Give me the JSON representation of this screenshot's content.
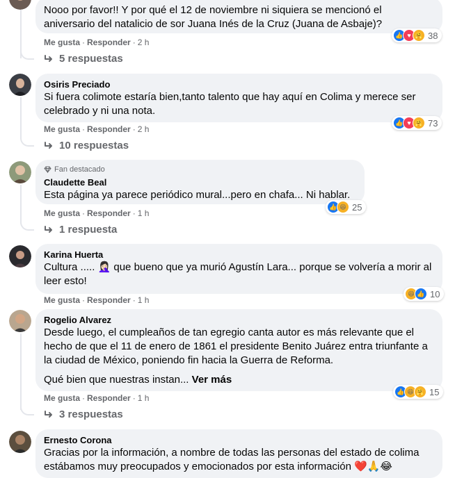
{
  "ui": {
    "like_label": "Me gusta",
    "reply_label": "Responder",
    "sep": "·",
    "fan_badge": "Fan destacado",
    "see_more": "Ver más"
  },
  "comments": [
    {
      "author": "",
      "text": "Nooo por favor!! Y por qué el 12 de noviembre ni siquiera se mencionó el aniversario del natalicio de sor Juana Inés de la Cruz (Juana de Asbaje)?",
      "time": "2 h",
      "reactions": [
        "like",
        "love",
        "care"
      ],
      "reaction_count": "38",
      "replies": "5 respuestas"
    },
    {
      "author": "Osiris Preciado",
      "text": "Si fuera colimote estaría bien,tanto talento que hay aquí en Colima y merece ser celebrado y ni una nota.",
      "time": "2 h",
      "reactions": [
        "like",
        "love",
        "care"
      ],
      "reaction_count": "73",
      "replies": "10 respuestas"
    },
    {
      "author": "Claudette Beal",
      "badge": "Fan destacado",
      "text": "Esta página ya parece periódico mural...pero en chafa... Ni hablar.",
      "time": "1 h",
      "reactions": [
        "like",
        "haha"
      ],
      "reaction_count": "25",
      "replies": "1 respuesta"
    },
    {
      "author": "Karina Huerta",
      "text": "Cultura ..... 🤦🏻‍♀️ que bueno que ya murió Agustín Lara... porque se volvería a morir al leer esto!",
      "time": "1 h",
      "reactions": [
        "haha",
        "like"
      ],
      "reaction_count": "10",
      "replies": ""
    },
    {
      "author": "Rogelio Alvarez",
      "text": "Desde luego, el cumpleaños de tan egregio canta autor es más relevante que el hecho de que el 11 de enero de 1861 el presidente Benito Juárez entra triunfante a la ciudad de México, poniendo fin hacia la Guerra de Reforma.",
      "text2": "Qué bien que nuestras instan...",
      "time": "1 h",
      "reactions": [
        "like",
        "haha",
        "care"
      ],
      "reaction_count": "15",
      "replies": "3 respuestas"
    },
    {
      "author": "Ernesto Corona",
      "text": "Gracias por la información, a nombre de todas las personas del estado de colima estábamos muy preocupados y emocionados por esta información ❤️🙏😂"
    }
  ]
}
